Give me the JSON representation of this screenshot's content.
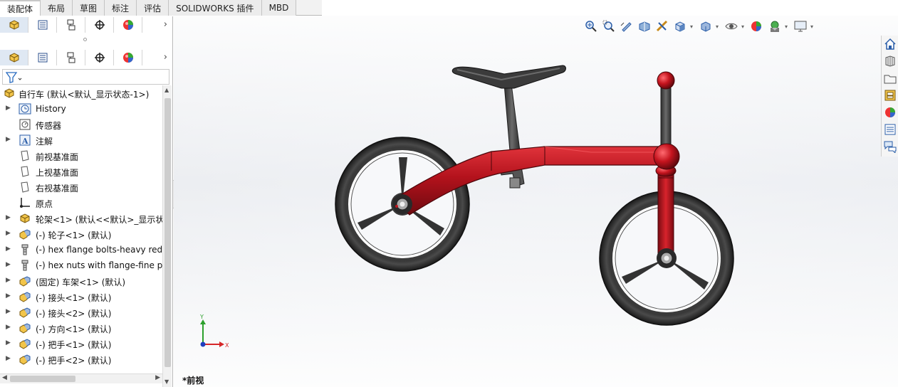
{
  "tabs": [
    {
      "label": "装配体",
      "active": true
    },
    {
      "label": "布局",
      "active": false
    },
    {
      "label": "草图",
      "active": false
    },
    {
      "label": "标注",
      "active": false
    },
    {
      "label": "评估",
      "active": false
    },
    {
      "label": "SOLIDWORKS 插件",
      "active": false
    },
    {
      "label": "MBD",
      "active": false
    }
  ],
  "tree": {
    "root": "自行车  (默认<默认_显示状态-1>)",
    "items": [
      {
        "label": "History",
        "icon": "history-icon",
        "expandable": true
      },
      {
        "label": "传感器",
        "icon": "sensor-icon",
        "expandable": false
      },
      {
        "label": "注解",
        "icon": "annotation-icon",
        "expandable": true
      },
      {
        "label": "前视基准面",
        "icon": "plane-icon",
        "expandable": false
      },
      {
        "label": "上视基准面",
        "icon": "plane-icon",
        "expandable": false
      },
      {
        "label": "右视基准面",
        "icon": "plane-icon",
        "expandable": false
      },
      {
        "label": "原点",
        "icon": "origin-icon",
        "expandable": false
      },
      {
        "label": "轮架<1> (默认<<默认>_显示状",
        "icon": "subassembly-icon",
        "expandable": true
      },
      {
        "label": "(-) 轮子<1> (默认)",
        "icon": "part-icon",
        "expandable": true
      },
      {
        "label": "(-) hex flange bolts-heavy redu",
        "icon": "bolt-icon",
        "expandable": true
      },
      {
        "label": "(-) hex nuts with flange-fine pi",
        "icon": "bolt-icon",
        "expandable": true
      },
      {
        "label": "(固定) 车架<1> (默认)",
        "icon": "part-icon",
        "expandable": true
      },
      {
        "label": "(-) 接头<1> (默认)",
        "icon": "part-icon",
        "expandable": true
      },
      {
        "label": "(-) 接头<2> (默认)",
        "icon": "part-icon",
        "expandable": true
      },
      {
        "label": "(-) 方向<1> (默认)",
        "icon": "part-icon",
        "expandable": true
      },
      {
        "label": "(-) 把手<1> (默认)",
        "icon": "part-icon",
        "expandable": true
      },
      {
        "label": "(-) 把手<2> (默认)",
        "icon": "part-icon",
        "expandable": true
      }
    ]
  },
  "viewport": {
    "view_name": "*前视",
    "axis_x": "X",
    "axis_y": "Y"
  },
  "colors": {
    "frame_red": "#b3121c",
    "tire_dark": "#2a2a2a",
    "accent_blue": "#1f5fbf"
  }
}
